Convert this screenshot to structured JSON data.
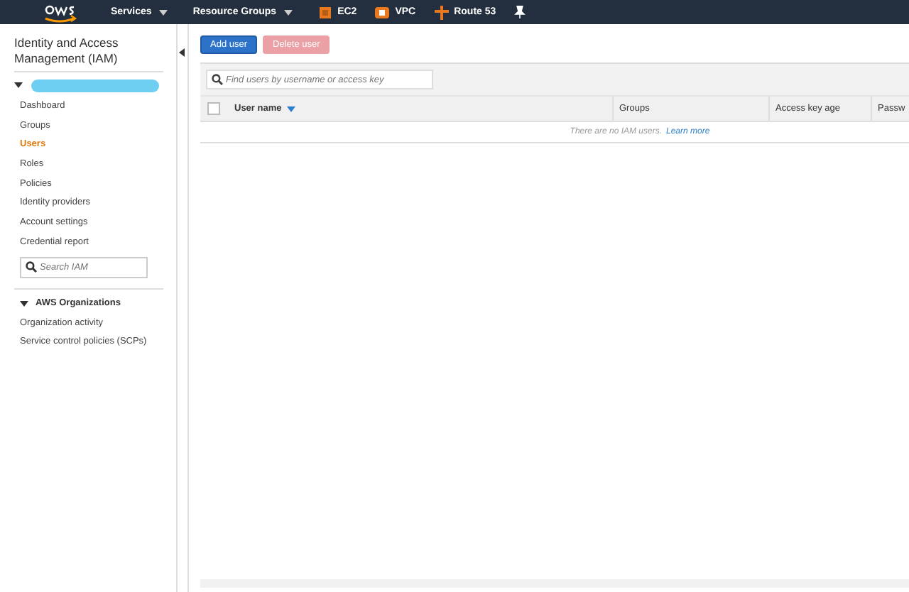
{
  "topbar": {
    "services": "Services",
    "resource_groups": "Resource Groups",
    "shortcuts": [
      {
        "label": "EC2",
        "kind": "ec2"
      },
      {
        "label": "VPC",
        "kind": "vpc"
      },
      {
        "label": "Route 53",
        "kind": "route53"
      }
    ]
  },
  "sidebar": {
    "title": "Identity and Access Management (IAM)",
    "account_expanded": true,
    "items": [
      {
        "label": "Dashboard",
        "selected": false
      },
      {
        "label": "Groups",
        "selected": false
      },
      {
        "label": "Users",
        "selected": true
      },
      {
        "label": "Roles",
        "selected": false
      },
      {
        "label": "Policies",
        "selected": false
      },
      {
        "label": "Identity providers",
        "selected": false
      },
      {
        "label": "Account settings",
        "selected": false
      },
      {
        "label": "Credential report",
        "selected": false
      }
    ],
    "search": {
      "placeholder": "Search IAM"
    },
    "organizations": {
      "title": "AWS Organizations",
      "expanded": true,
      "items": [
        {
          "label": "Organization activity",
          "selected": false
        },
        {
          "label": "Service control policies (SCPs)",
          "selected": false
        }
      ]
    }
  },
  "toolbar": {
    "buttons": [
      {
        "label": "Add user",
        "disabled": false,
        "kind": "primary"
      },
      {
        "label": "Delete user",
        "disabled": true,
        "kind": "danger"
      }
    ]
  },
  "table": {
    "search": {
      "placeholder": "Find users by username or access key"
    },
    "columns": [
      {
        "label": "User name",
        "sorted": true
      },
      {
        "label": "Groups"
      },
      {
        "label": "Access key age"
      },
      {
        "label": "Passw"
      }
    ],
    "select_all": {
      "checked": false
    },
    "empty_message": "There are no IAM users.",
    "empty_link": "Learn more"
  }
}
